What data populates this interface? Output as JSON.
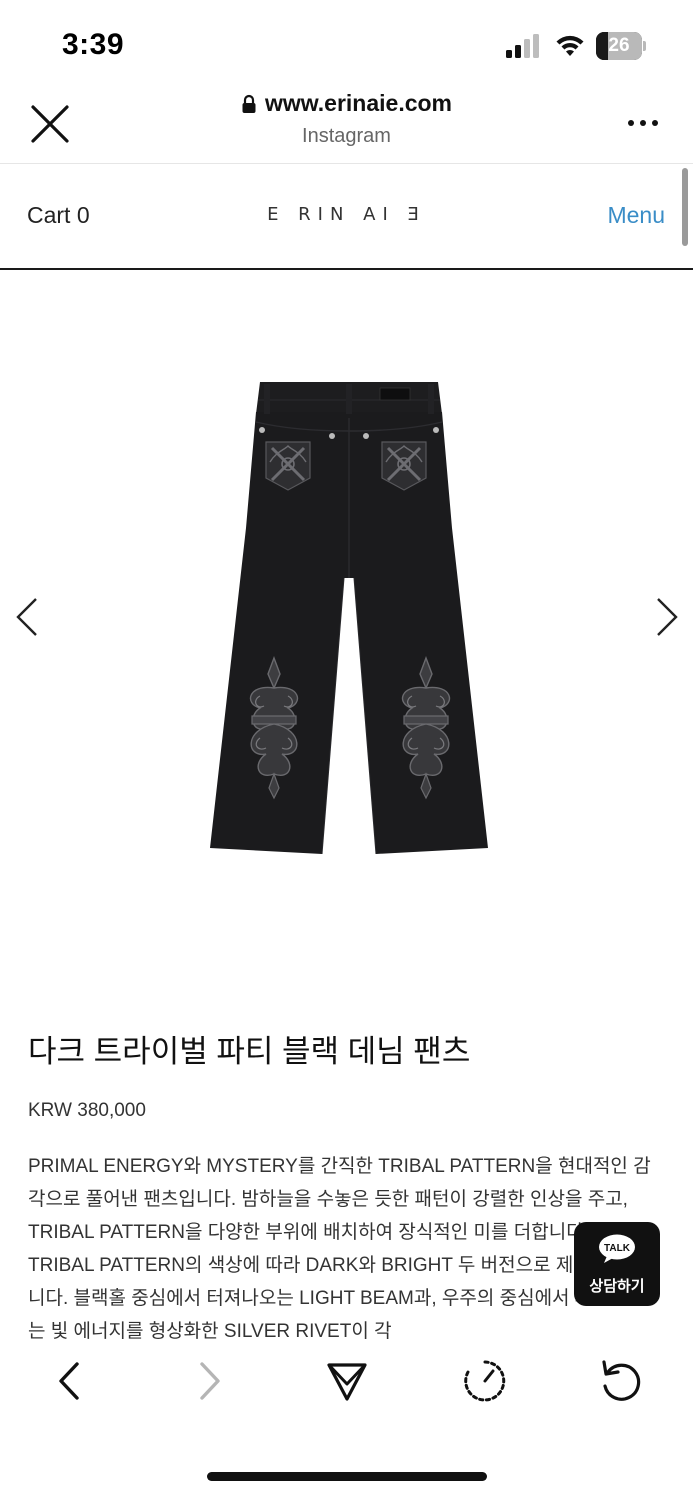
{
  "status_bar": {
    "time": "3:39",
    "battery_level": "26"
  },
  "browser": {
    "url": "www.erinaie.com",
    "source": "Instagram"
  },
  "site_nav": {
    "cart_label": "Cart 0",
    "logo_text": "E RIN AI Ǝ",
    "menu_label": "Menu"
  },
  "product": {
    "title": "다크 트라이벌 파티 블랙 데님 팬츠",
    "price": "KRW 380,000",
    "description": "PRIMAL ENERGY와 MYSTERY를 간직한 TRIBAL PATTERN을 현대적인 감각으로 풀어낸 팬츠입니다. 밤하늘을 수놓은 듯한 패턴이 강렬한 인상을 주고, TRIBAL PATTERN을 다양한 부위에 배치하여 장식적인 미를 더합니다. TRIBAL PATTERN의 색상에 따라 DARK와 BRIGHT 두 버전으로 제작하였습니다. 블랙홀 중심에서 터져나오는 LIGHT BEAM과, 우주의 중심에서 퍼져나가는 빛 에너지를 형상화한 SILVER RIVET이 각"
  },
  "chat_widget": {
    "bubble_text": "TALK",
    "label": "상담하기"
  },
  "colors": {
    "accent": "#3a8dc7",
    "text": "#222222",
    "denim": "#1b1b1d"
  },
  "icons": {
    "close": "close-icon",
    "lock": "lock-icon",
    "more": "more-icon",
    "prev": "chevron-left-icon",
    "next": "chevron-right-icon",
    "back": "back-icon",
    "forward": "forward-icon",
    "share": "send-icon",
    "history": "history-icon",
    "reload": "reload-icon"
  }
}
